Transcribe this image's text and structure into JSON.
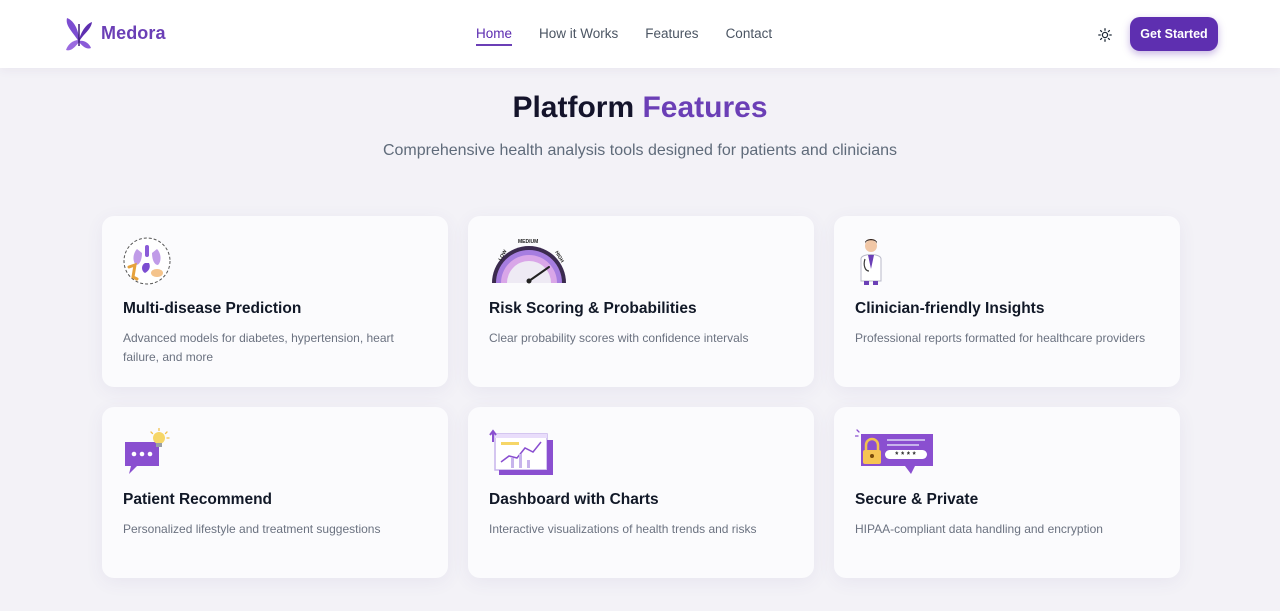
{
  "header": {
    "brand": "Medora",
    "nav": [
      {
        "label": "Home",
        "active": true
      },
      {
        "label": "How it Works",
        "active": false
      },
      {
        "label": "Features",
        "active": false
      },
      {
        "label": "Contact",
        "active": false
      }
    ],
    "theme_toggle_icon": "sun-icon",
    "cta_label": "Get Started"
  },
  "section": {
    "title_main": "Platform",
    "title_accent": "Features",
    "subtitle": "Comprehensive health analysis tools designed for patients and clinicians"
  },
  "features": [
    {
      "icon": "organs-illustration-icon",
      "title": "Multi-disease Prediction",
      "description": "Advanced models for diabetes, hypertension, heart failure, and more"
    },
    {
      "icon": "risk-gauge-icon",
      "title": "Risk Scoring & Probabilities",
      "description": "Clear probability scores with confidence intervals",
      "gauge_labels": [
        "LOW",
        "MEDIUM",
        "HIGH"
      ]
    },
    {
      "icon": "doctor-icon",
      "title": "Clinician-friendly Insights",
      "description": "Professional reports formatted for healthcare providers"
    },
    {
      "icon": "chat-lightbulb-icon",
      "title": "Patient Recommend",
      "description": "Personalized lifestyle and treatment suggestions"
    },
    {
      "icon": "dashboard-chart-icon",
      "title": "Dashboard with Charts",
      "description": "Interactive visualizations of health trends and risks"
    },
    {
      "icon": "lock-password-icon",
      "title": "Secure & Private",
      "description": "HIPAA-compliant data handling and encryption",
      "password_mask": "****"
    }
  ],
  "colors": {
    "brand": "#6b3fb6",
    "cta": "#5e2fb0",
    "background": "#f3f2f7",
    "card": "#fbfbfd"
  }
}
